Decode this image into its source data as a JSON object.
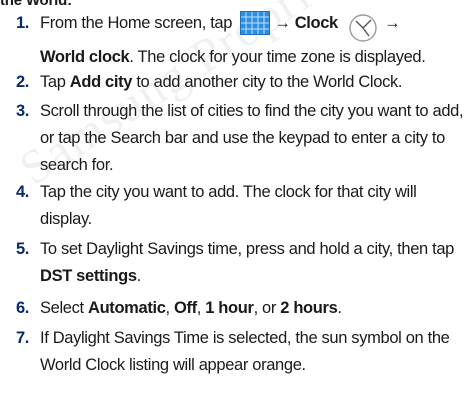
{
  "watermark": "Samsung Proprietary",
  "intro": "the World:",
  "steps": [
    {
      "n": "1.",
      "a": "From the Home screen, tap",
      "arrow1": "→",
      "clock_word": "Clock",
      "arrow2": "→",
      "world_clock": "World clock",
      "rest": ". The clock for your time zone is displayed."
    },
    {
      "n": "2.",
      "a": "Tap ",
      "b": "Add city",
      "c": " to add another city to the World Clock."
    },
    {
      "n": "3.",
      "text": "Scroll through the list of cities to find the city you want to add, or tap the Search bar and use the keypad to enter a city to search for."
    },
    {
      "n": "4.",
      "text": "Tap the city you want to add. The clock for that city will display."
    },
    {
      "n": "5.",
      "a": "To set Daylight Savings time, press and hold a city, then tap ",
      "b": "DST settings",
      "c": "."
    },
    {
      "n": "6.",
      "a": "Select ",
      "o1": "Automatic",
      "s1": ", ",
      "o2": "Off",
      "s2": ", ",
      "o3": "1 hour",
      "s3": ", or ",
      "o4": "2 hours",
      "s4": "."
    },
    {
      "n": "7.",
      "text": "If Daylight Savings Time is selected, the sun symbol on the World Clock listing will appear orange."
    }
  ],
  "icons": {
    "apps": "apps-grid-icon",
    "clock": "clock-icon"
  },
  "colors": {
    "step_number": "#0a2a70",
    "apps_icon": "#2e8fe0",
    "text": "#1a1a1a"
  }
}
